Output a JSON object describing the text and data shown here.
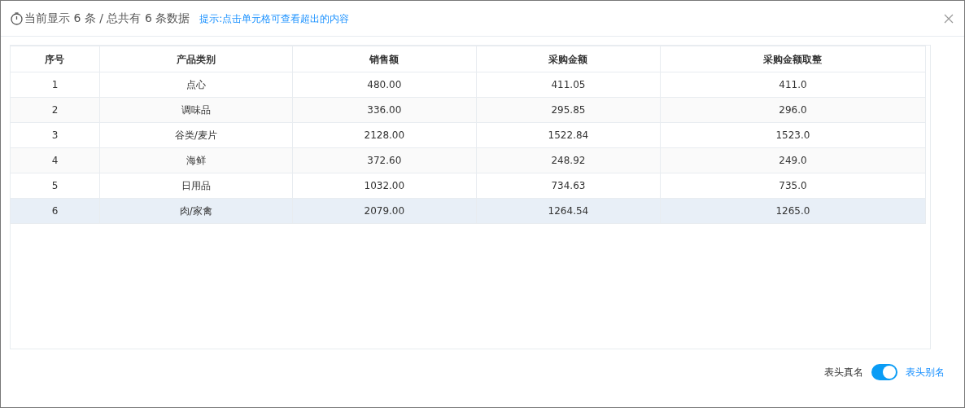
{
  "header": {
    "summary": "当前显示 6 条 / 总共有 6 条数据",
    "hint": "提示:点击单元格可查看超出的内容"
  },
  "table": {
    "columns": [
      "序号",
      "产品类别",
      "销售额",
      "采购金额",
      "采购金额取整"
    ],
    "rows": [
      {
        "cells": [
          "1",
          "点心",
          "480.00",
          "411.05",
          "411.0"
        ],
        "selected": false
      },
      {
        "cells": [
          "2",
          "调味品",
          "336.00",
          "295.85",
          "296.0"
        ],
        "selected": false
      },
      {
        "cells": [
          "3",
          "谷类/麦片",
          "2128.00",
          "1522.84",
          "1523.0"
        ],
        "selected": false
      },
      {
        "cells": [
          "4",
          "海鲜",
          "372.60",
          "248.92",
          "249.0"
        ],
        "selected": false
      },
      {
        "cells": [
          "5",
          "日用品",
          "1032.00",
          "734.63",
          "735.0"
        ],
        "selected": false
      },
      {
        "cells": [
          "6",
          "肉/家禽",
          "2079.00",
          "1264.54",
          "1265.0"
        ],
        "selected": true
      }
    ]
  },
  "switch": {
    "off_label": "表头真名",
    "on_label": "表头别名",
    "on": true
  }
}
